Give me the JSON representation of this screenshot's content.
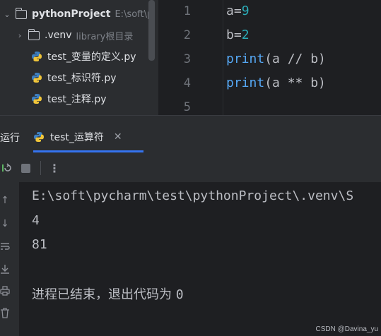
{
  "project_tree": {
    "root": {
      "name": "pythonProject",
      "path": "E:\\soft\\p"
    },
    "items": [
      {
        "label": ".venv",
        "hint": "library根目录"
      },
      {
        "label": "test_变量的定义.py"
      },
      {
        "label": "test_标识符.py"
      },
      {
        "label": "test_注释.py"
      }
    ]
  },
  "editor": {
    "line_numbers": [
      "1",
      "2",
      "3",
      "4",
      "5"
    ],
    "lines": [
      {
        "a": "a=",
        "b": "9"
      },
      {
        "a": "b=",
        "b": "2"
      },
      {
        "fn": "print",
        "rest": "(a // b)"
      },
      {
        "fn": "print",
        "rest": "(a ** b)"
      }
    ]
  },
  "run_panel": {
    "title": "运行",
    "tab_label": "test_运算符",
    "tab_close": "✕",
    "more_label": "⋮"
  },
  "console": {
    "command": "E:\\soft\\pycharm\\test\\pythonProject\\.venv\\S",
    "output": [
      "4",
      "81"
    ],
    "exit_message": "进程已结束，退出代码为",
    "exit_code": "0"
  },
  "watermark": "CSDN @Davina_yu",
  "colors": {
    "accent": "#3574f0",
    "number": "#2aacb8",
    "function": "#56a8f5"
  }
}
